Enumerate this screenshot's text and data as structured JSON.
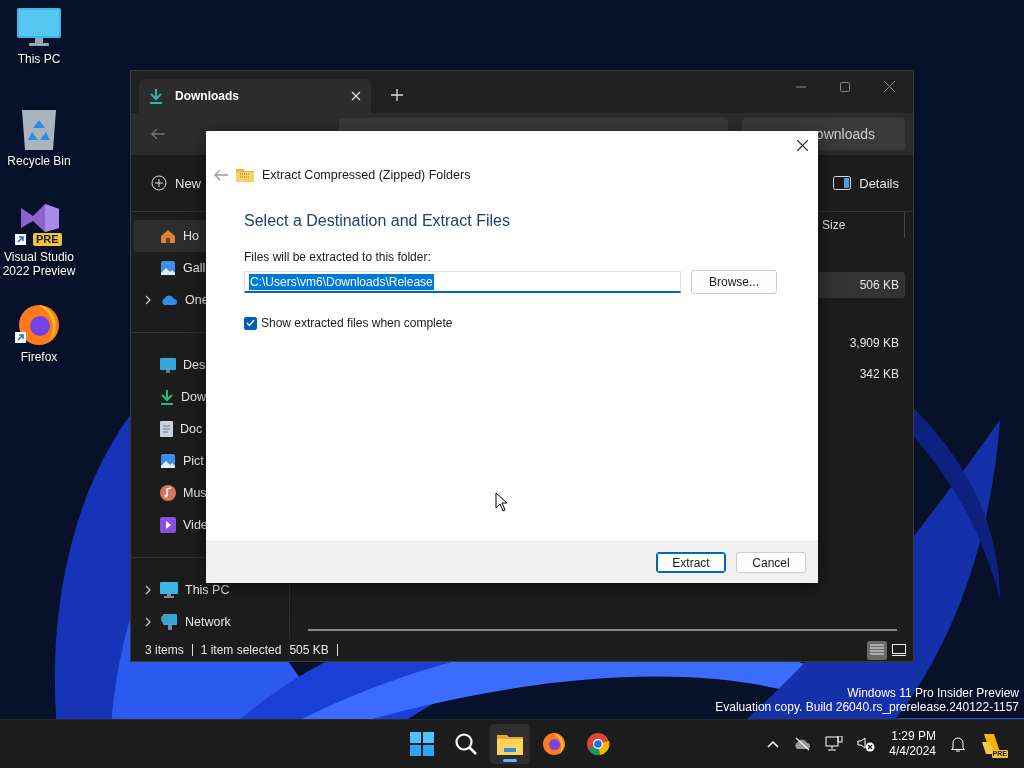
{
  "desktop_icons": [
    {
      "label": "This PC",
      "kind": "pc",
      "shortcut": false
    },
    {
      "label": "Recycle Bin",
      "kind": "recycle",
      "shortcut": false
    },
    {
      "label": "Visual Studio 2022 Preview",
      "kind": "vs",
      "shortcut": true,
      "badge": "PRE"
    },
    {
      "label": "Firefox",
      "kind": "firefox",
      "shortcut": true
    }
  ],
  "explorer": {
    "tab": {
      "title": "Downloads"
    },
    "search": {
      "placeholder": "ownloads"
    },
    "commands": [
      {
        "label": "New",
        "kind": "new"
      },
      {
        "label": "Details",
        "kind": "details"
      }
    ],
    "sidebar": [
      {
        "items": [
          {
            "label": "Ho",
            "kind": "home",
            "expandable": false,
            "selected": true
          },
          {
            "label": "Gall",
            "kind": "gallery",
            "expandable": false,
            "selected": false
          },
          {
            "label": "One",
            "kind": "cloud",
            "expandable": true,
            "selected": false
          }
        ]
      },
      {
        "items": [
          {
            "label": "Des",
            "kind": "desktop",
            "expandable": false,
            "selected": false
          },
          {
            "label": "Dow",
            "kind": "download",
            "expandable": false,
            "selected": false
          },
          {
            "label": "Doc",
            "kind": "document",
            "expandable": false,
            "selected": false
          },
          {
            "label": "Pict",
            "kind": "gallery",
            "expandable": false,
            "selected": false
          },
          {
            "label": "Mus",
            "kind": "music",
            "expandable": false,
            "selected": false
          },
          {
            "label": "Vide",
            "kind": "video",
            "expandable": false,
            "selected": false
          }
        ]
      },
      {
        "items": [
          {
            "label": "This PC",
            "kind": "pc",
            "expandable": true,
            "selected": false
          },
          {
            "label": "Network",
            "kind": "network",
            "expandable": true,
            "selected": false
          }
        ]
      }
    ],
    "columns": [
      {
        "label": "Size"
      }
    ],
    "rows": [
      {
        "size": "506 KB",
        "selected": true
      },
      {
        "size": "3,909 KB",
        "selected": false
      },
      {
        "size": "342 KB",
        "selected": false
      }
    ],
    "status_bar": {
      "count": "3 items",
      "selection": "1 item selected",
      "size": "505 KB"
    },
    "views": [
      {
        "kind": "details",
        "selected": true
      },
      {
        "kind": "tiles",
        "selected": false
      }
    ]
  },
  "dialog": {
    "title": "Extract Compressed (Zipped) Folders",
    "heading": "Select a Destination and Extract Files",
    "folder_label": "Files will be extracted to this folder:",
    "folder": {
      "value": "C:\\Users\\vm6\\Downloads\\Release",
      "highlighted": true
    },
    "browse": "Browse...",
    "show_files": {
      "label": "Show extracted files when complete",
      "checked": true
    },
    "buttons": [
      {
        "label": "Extract",
        "default": true
      },
      {
        "label": "Cancel",
        "default": false
      }
    ]
  },
  "watermark": [
    "Windows 11 Pro Insider Preview",
    "Evaluation copy. Build 26040.rs_prerelease.240122-1157"
  ],
  "taskbar": {
    "apps": [
      {
        "kind": "start",
        "active": false
      },
      {
        "kind": "search",
        "active": false
      },
      {
        "kind": "explorer",
        "active": true
      },
      {
        "kind": "firefox",
        "active": false
      },
      {
        "kind": "chrome",
        "active": false
      }
    ],
    "tray": [
      {
        "kind": "chevron"
      },
      {
        "kind": "cloud-off"
      },
      {
        "kind": "network"
      },
      {
        "kind": "volume-muted"
      }
    ],
    "clock": {
      "time": "1:29 PM",
      "date": "4/4/2024"
    },
    "copilot_badge": "PRE"
  }
}
